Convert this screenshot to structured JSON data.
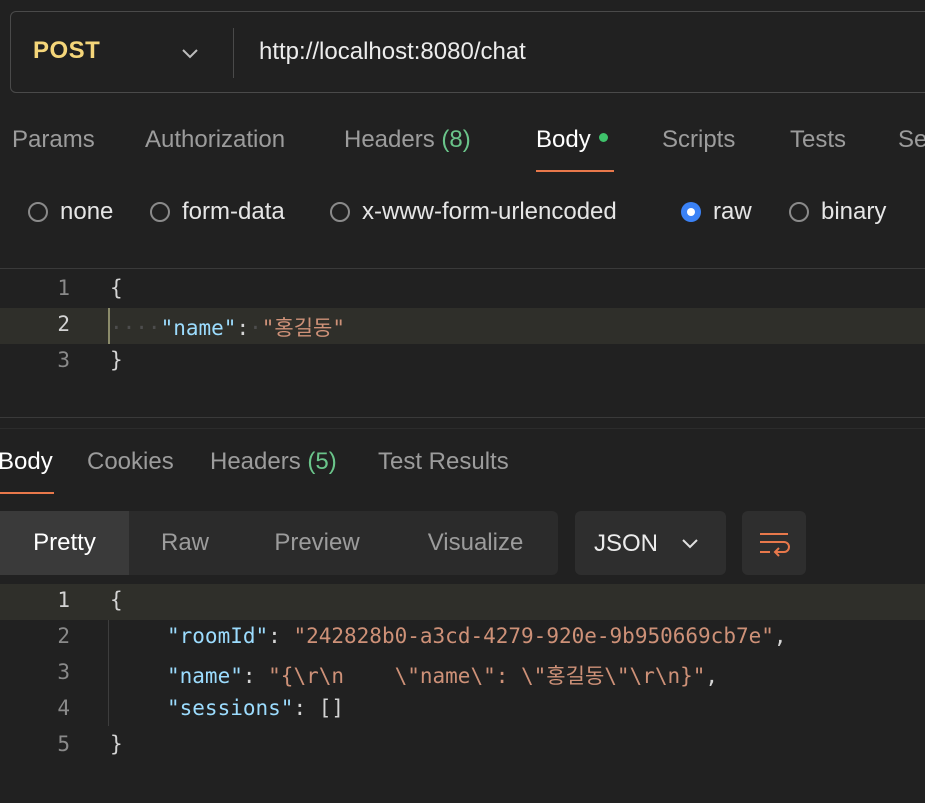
{
  "request": {
    "method": "POST",
    "url": "http://localhost:8080/chat",
    "method_color": "#f5d67a"
  },
  "request_tabs": [
    {
      "label": "Params"
    },
    {
      "label": "Authorization"
    },
    {
      "label": "Headers",
      "count": "(8)"
    },
    {
      "label": "Body",
      "active": true
    },
    {
      "label": "Scripts"
    },
    {
      "label": "Tests"
    },
    {
      "label": "Se"
    }
  ],
  "body_types": [
    {
      "label": "none",
      "checked": false
    },
    {
      "label": "form-data",
      "checked": false
    },
    {
      "label": "x-www-form-urlencoded",
      "checked": false
    },
    {
      "label": "raw",
      "checked": true
    },
    {
      "label": "binary",
      "checked": false
    }
  ],
  "request_body": {
    "lines": [
      {
        "n": "1",
        "open": "{"
      },
      {
        "n": "2",
        "dots": "····",
        "key": "\"name\"",
        "sep": ":",
        "dot_after": "·",
        "value": "\"홍길동\""
      },
      {
        "n": "3",
        "close": "}"
      }
    ]
  },
  "response_tabs": [
    {
      "label": "Body",
      "active": true
    },
    {
      "label": "Cookies"
    },
    {
      "label": "Headers",
      "count": "(5)"
    },
    {
      "label": "Test Results"
    }
  ],
  "view_modes": [
    "Pretty",
    "Raw",
    "Preview",
    "Visualize"
  ],
  "format": "JSON",
  "wrap_icon": "wrap-lines-icon",
  "response_body": {
    "lines": [
      {
        "n": "1",
        "open": "{"
      },
      {
        "n": "2",
        "key": "\"roomId\"",
        "sep": ": ",
        "value": "\"242828b0-a3cd-4279-920e-9b950669cb7e\"",
        "end": ","
      },
      {
        "n": "3",
        "key": "\"name\"",
        "sep": ": ",
        "value": "\"{\\r\\n    \\\"name\\\": \\\"홍길동\\\"\\r\\n}\"",
        "end": ","
      },
      {
        "n": "4",
        "key": "\"sessions\"",
        "sep": ": ",
        "value": "[]",
        "end": ""
      },
      {
        "n": "5",
        "close": "}"
      }
    ]
  },
  "colors": {
    "accent": "#e8784b",
    "count_green": "#6ac48a",
    "radio_checked": "#3b82f6",
    "json_key": "#9cdcfe",
    "json_string": "#ce9178"
  }
}
